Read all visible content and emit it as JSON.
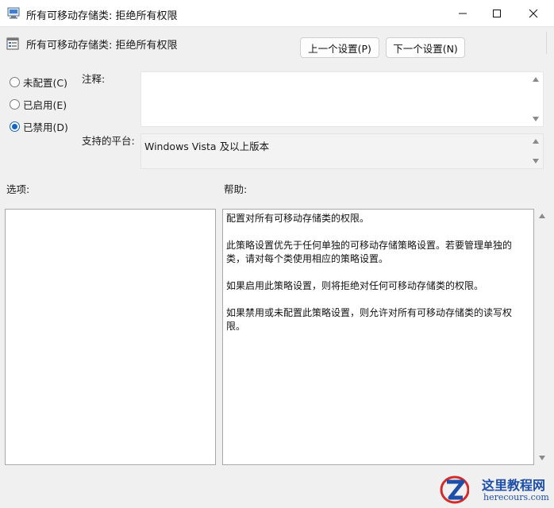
{
  "window": {
    "title": "所有可移动存储类: 拒绝所有权限",
    "controls": {
      "minimize": "minimize-icon",
      "maximize": "maximize-icon",
      "close": "close-icon"
    }
  },
  "header": {
    "title": "所有可移动存储类: 拒绝所有权限",
    "prev_button": "上一个设置(P)",
    "next_button": "下一个设置(N)"
  },
  "state": {
    "options": [
      {
        "label": "未配置(C)",
        "checked": false
      },
      {
        "label": "已启用(E)",
        "checked": false
      },
      {
        "label": "已禁用(D)",
        "checked": true
      }
    ]
  },
  "comment": {
    "label": "注释:",
    "value": ""
  },
  "platform": {
    "label": "支持的平台:",
    "value": "Windows Vista 及以上版本"
  },
  "options_section": {
    "label": "选项:"
  },
  "help_section": {
    "label": "帮助:",
    "paragraphs": [
      "配置对所有可移动存储类的权限。",
      "此策略设置优先于任何单独的可移动存储策略设置。若要管理单独的类，请对每个类使用相应的策略设置。",
      "如果启用此策略设置，则将拒绝对任何可移动存储类的权限。",
      "如果禁用或未配置此策略设置，则允许对所有可移动存储类的读写权限。"
    ]
  },
  "watermark": {
    "name_cn": "这里教程网",
    "site": "herecours.com"
  },
  "colors": {
    "accent": "#1565c0",
    "watermark": "#1d4fa8"
  }
}
